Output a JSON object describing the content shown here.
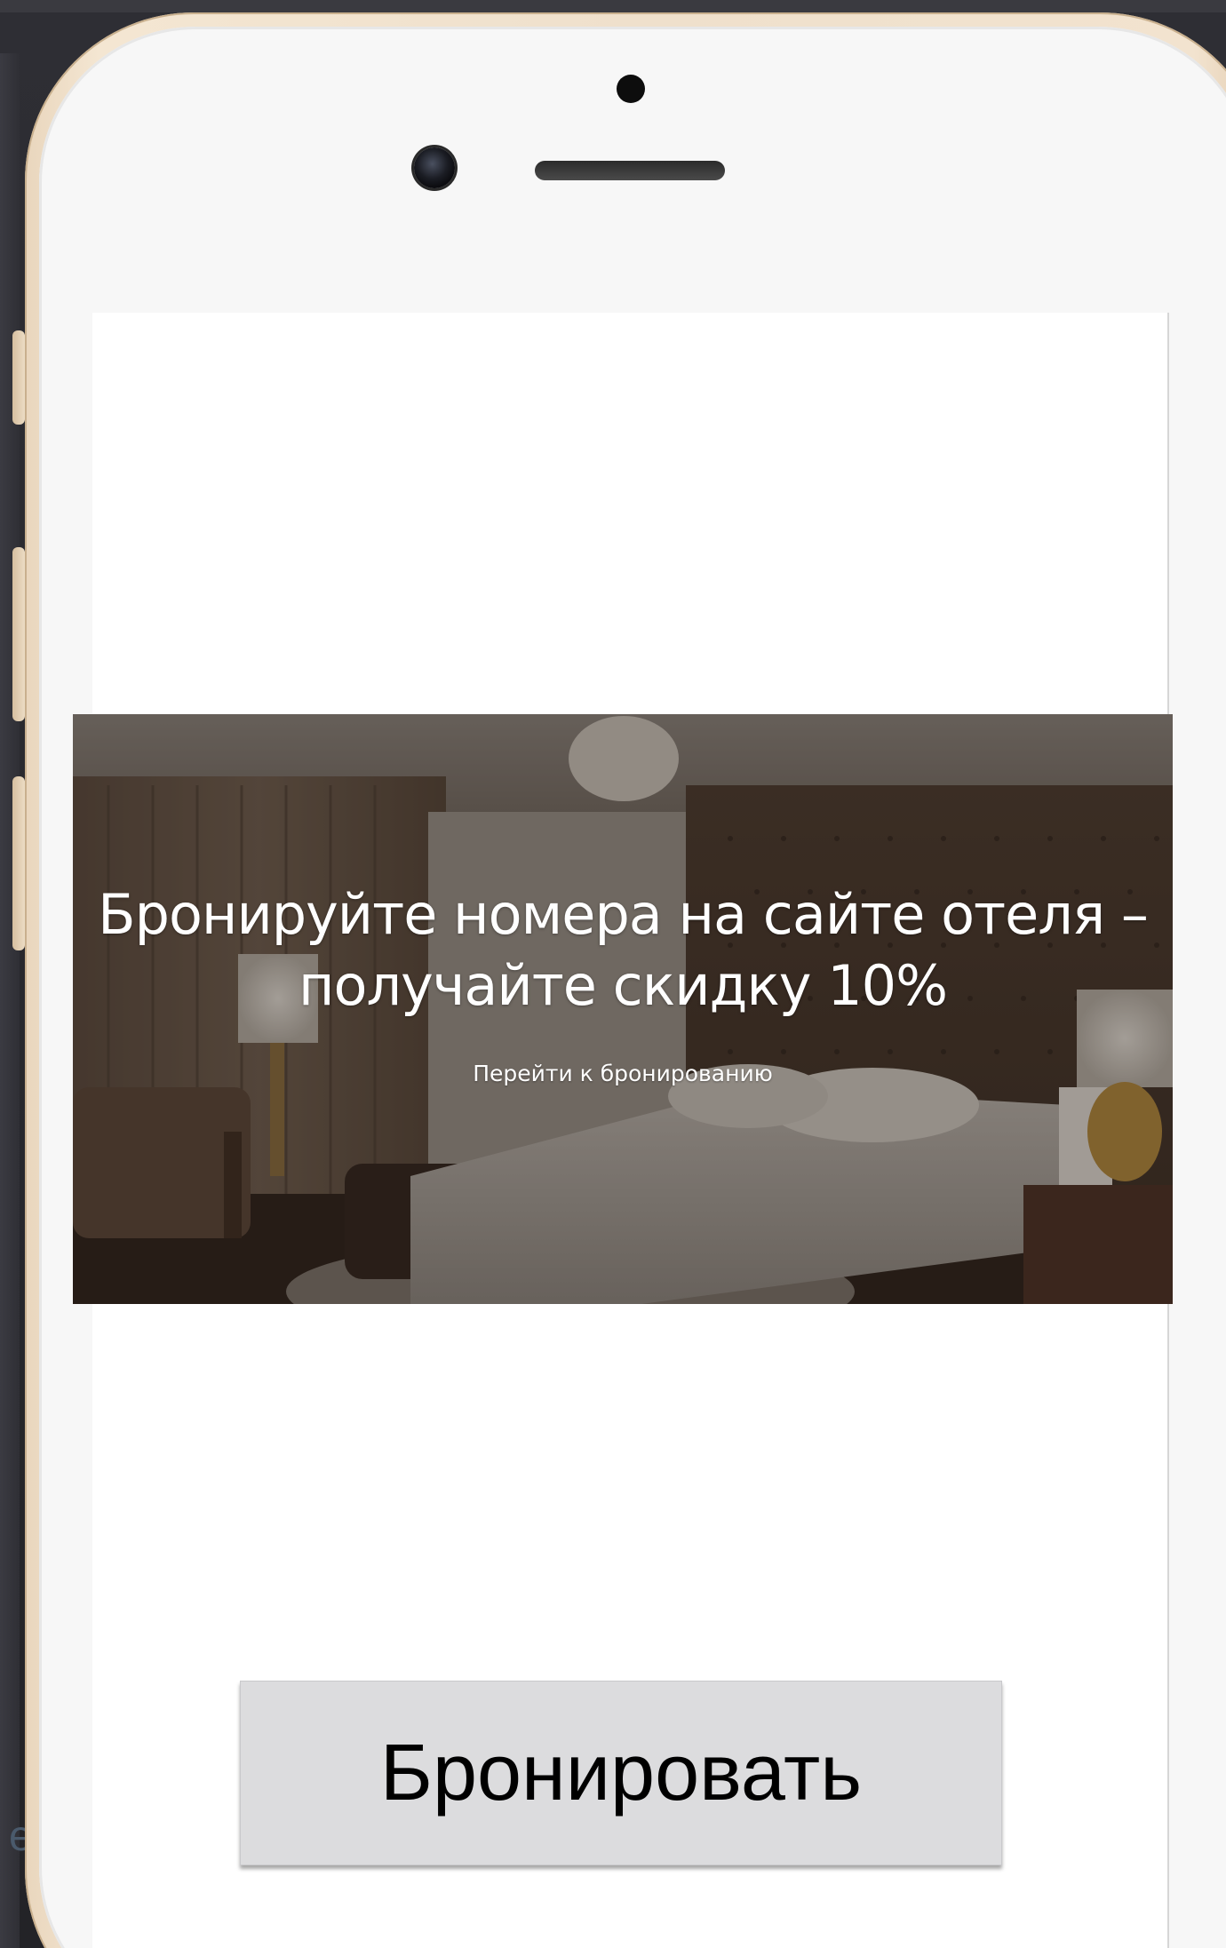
{
  "hero": {
    "title_line1": "Бронируйте номера на сайте отеля –",
    "title_line2": "получайте скидку 10%",
    "link_text": "Перейти к бронированию"
  },
  "actions": {
    "book_label": "Бронировать"
  },
  "colors": {
    "device_frame": "#efe0cc",
    "screen": "#ffffff",
    "button_bg": "#dcdcde",
    "hero_overlay": "#3d332c"
  },
  "icons": [
    "front-camera-icon",
    "sensor-dot-icon",
    "earpiece-speaker-icon"
  ],
  "background": {
    "partial_letter": "e"
  }
}
